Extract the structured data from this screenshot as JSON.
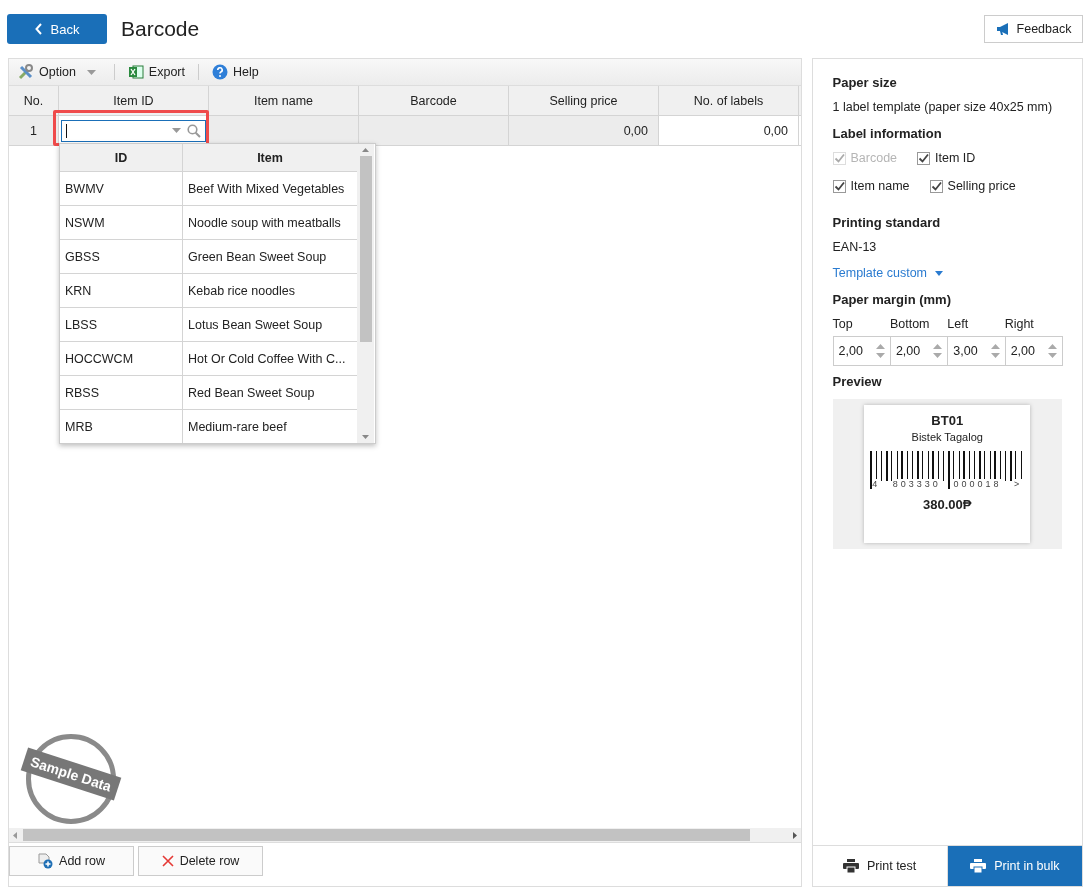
{
  "header": {
    "back_label": "Back",
    "title": "Barcode",
    "feedback_label": "Feedback"
  },
  "toolbar": [
    {
      "kind": "option",
      "label": "Option"
    },
    {
      "kind": "export",
      "label": "Export"
    },
    {
      "kind": "help",
      "label": "Help"
    }
  ],
  "grid": {
    "columns": [
      "No.",
      "Item ID",
      "Item name",
      "Barcode",
      "Selling price",
      "No. of labels"
    ],
    "rows": [
      {
        "no": "1",
        "selling_price": "0,00",
        "labels": "0,00"
      }
    ]
  },
  "lookup": {
    "columns": [
      "ID",
      "Item"
    ],
    "rows": [
      {
        "id": "BWMV",
        "item": "Beef With Mixed Vegetables"
      },
      {
        "id": "NSWM",
        "item": "Noodle soup with meatballs"
      },
      {
        "id": "GBSS",
        "item": "Green Bean Sweet Soup"
      },
      {
        "id": "KRN",
        "item": "Kebab rice noodles"
      },
      {
        "id": "LBSS",
        "item": "Lotus Bean Sweet Soup"
      },
      {
        "id": "HOCCWCM",
        "item": "Hot Or Cold Coffee With C..."
      },
      {
        "id": "RBSS",
        "item": "Red Bean Sweet Soup"
      },
      {
        "id": "MRB",
        "item": "Medium-rare beef"
      }
    ]
  },
  "stamp": "Sample Data",
  "row_buttons": [
    {
      "kind": "add",
      "label": "Add row"
    },
    {
      "kind": "delete",
      "label": "Delete row"
    }
  ],
  "settings": {
    "paper_size_title": "Paper size",
    "paper_size": "1 label template (paper size 40x25 mm)",
    "label_info_title": "Label information",
    "checkbox_rows": [
      [
        {
          "label": "Barcode",
          "checked": true,
          "disabled": true
        },
        {
          "label": "Item ID",
          "checked": true,
          "disabled": false
        }
      ],
      [
        {
          "label": "Item name",
          "checked": true,
          "disabled": false
        },
        {
          "label": "Selling price",
          "checked": true,
          "disabled": false
        }
      ]
    ],
    "standard_title": "Printing standard",
    "standard": "EAN-13",
    "template_link": "Template custom",
    "margin_title": "Paper margin (mm)",
    "margins": [
      {
        "label": "Top",
        "value": "2,00"
      },
      {
        "label": "Bottom",
        "value": "2,00"
      },
      {
        "label": "Left",
        "value": "3,00"
      },
      {
        "label": "Right",
        "value": "2,00"
      }
    ],
    "preview_title": "Preview",
    "label": {
      "code": "BT01",
      "name": "Bistek Tagalog",
      "digits": [
        "4",
        "803330",
        "000018",
        ">"
      ],
      "price": "380.00₱"
    }
  },
  "print_buttons": [
    {
      "label": "Print test",
      "selected": false
    },
    {
      "label": "Print in bulk",
      "selected": true
    }
  ]
}
